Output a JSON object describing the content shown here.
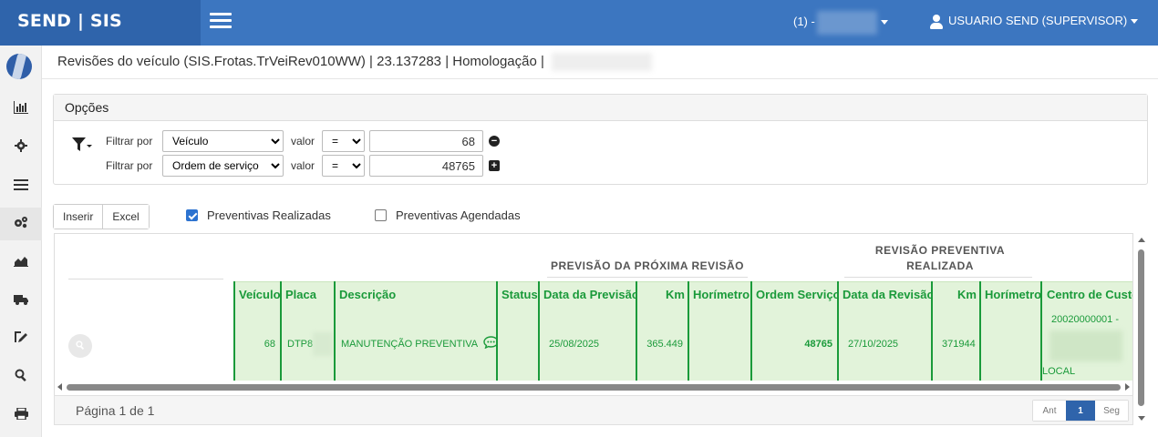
{
  "topbar": {
    "brand": "SEND | SIS",
    "company": "(1) -",
    "user": "USUARIO SEND (SUPERVISOR)"
  },
  "sidebar": {
    "items": [
      "chart-bars-icon",
      "gear-icon",
      "list-icon",
      "gears-icon",
      "area-chart-icon",
      "truck-icon",
      "pen-icon",
      "search-icon",
      "print-icon"
    ]
  },
  "page": {
    "title": "Revisões do veículo (SIS.Frotas.TrVeiRev010WW) | 23.137283 | Homologação |"
  },
  "options": {
    "title": "Opções",
    "filters": [
      {
        "label": "Filtrar por",
        "field": "Veículo",
        "value_label": "valor",
        "operator": "=",
        "value": "68",
        "action": "remove"
      },
      {
        "label": "Filtrar por",
        "field": "Ordem de serviço",
        "value_label": "valor",
        "operator": "=",
        "value": "48765",
        "action": "add"
      }
    ]
  },
  "actions": {
    "insert": "Inserir",
    "excel": "Excel",
    "check_done": "Preventivas Realizadas",
    "check_done_checked": true,
    "check_scheduled": "Preventivas Agendadas",
    "check_scheduled_checked": false
  },
  "grid": {
    "group_next": "PREVISÃO DA PRÓXIMA REVISÃO",
    "group_done_1": "REVISÃO PREVENTIVA",
    "group_done_2": "REALIZADA",
    "columns": [
      "Veículo",
      "Placa",
      "Descrição",
      "Status",
      "Data da Previsão",
      "Km",
      "Horímetro",
      "Ordem Serviço",
      "Data da Revisão",
      "Km",
      "Horímetro",
      "Centro de Custo"
    ],
    "row": {
      "veiculo": "68",
      "placa": "DTP8",
      "descricao": "MANUTENÇÃO PREVENTIVA",
      "status": "",
      "data_previsao": "25/08/2025",
      "km_previsao": "365.449",
      "horimetro_previsao": "",
      "ordem_servico": "48765",
      "data_revisao": "27/10/2025",
      "km_revisao": "371944",
      "horimetro_revisao": "",
      "centro_custo_code": "20020000001 -",
      "centro_custo_local": "LOCAL"
    }
  },
  "footer": {
    "page_info": "Página 1 de 1",
    "prev": "Ant",
    "current": "1",
    "next": "Seg"
  }
}
